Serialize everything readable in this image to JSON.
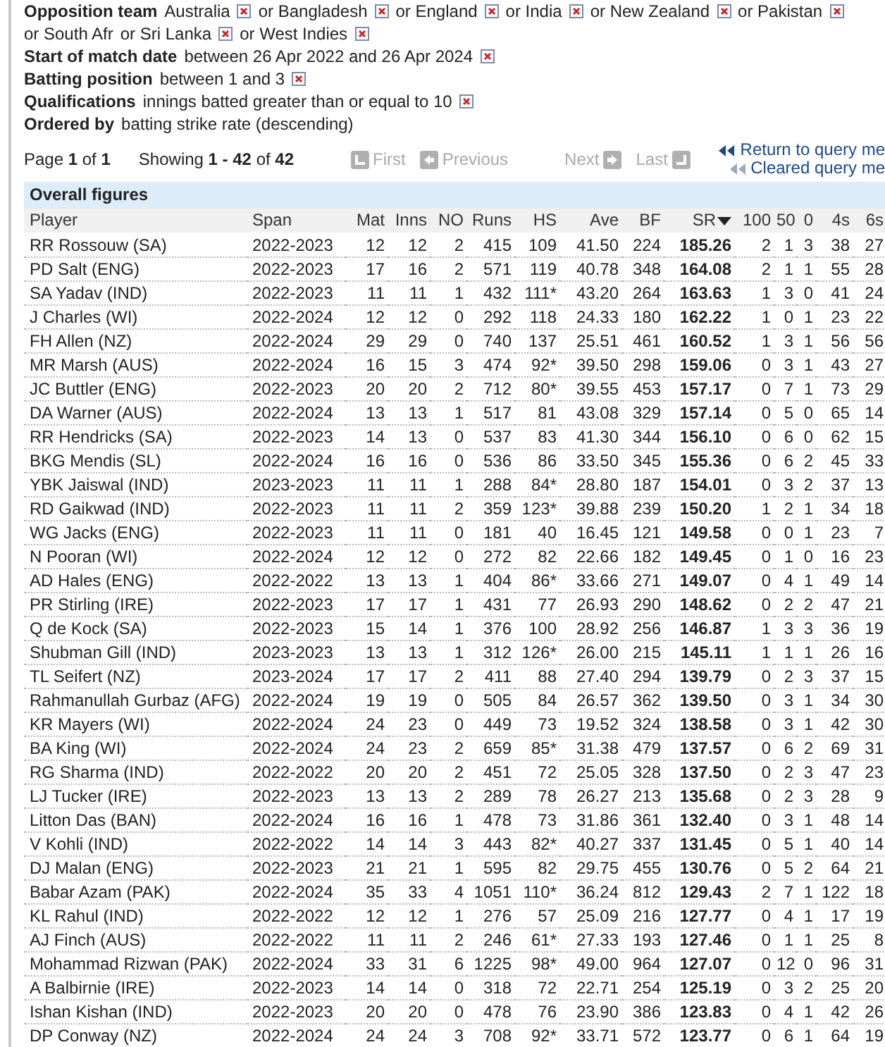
{
  "filters": [
    {
      "label": "Opposition team",
      "values": [
        {
          "text": "Australia",
          "remove_icon": true
        },
        {
          "text": "or Bangladesh",
          "remove_icon": true
        },
        {
          "text": "or England",
          "remove_icon": true
        },
        {
          "text": "or India",
          "remove_icon": true
        },
        {
          "text": "or New Zealand",
          "remove_icon": true
        },
        {
          "text": "or Pakistan",
          "remove_icon": true
        },
        {
          "text": "or South Afr"
        },
        {
          "text": "or Sri Lanka",
          "remove_icon": true
        },
        {
          "text": "or West Indies",
          "remove_icon": true
        }
      ]
    },
    {
      "label": "Start of match date",
      "values": [
        {
          "text": "between 26 Apr 2022 and 26 Apr 2024",
          "remove_icon": true
        }
      ]
    },
    {
      "label": "Batting position",
      "values": [
        {
          "text": "between 1 and 3",
          "remove_icon": true
        }
      ]
    },
    {
      "label": "Qualifications",
      "values": [
        {
          "text": "innings batted greater than or equal to 10",
          "remove_icon": true
        }
      ]
    },
    {
      "label": "Ordered by",
      "values": [
        {
          "text": "batting strike rate (descending)"
        }
      ]
    }
  ],
  "pagination": {
    "page": "Page **1** of **1**",
    "showing": "Showing **1 - 42** of **42**",
    "nav": [
      {
        "kind": "first",
        "label": "First",
        "disabled": true
      },
      {
        "kind": "previous",
        "label": "Previous",
        "disabled": true
      },
      {
        "kind": "next",
        "label": "Next",
        "disabled": true
      },
      {
        "kind": "last",
        "label": "Last",
        "disabled": true
      }
    ],
    "links": [
      {
        "kind": "return",
        "label": "Return to query me"
      },
      {
        "kind": "cleared",
        "label": "Cleared query me"
      }
    ]
  },
  "table": {
    "title": "Overall figures",
    "columns": [
      {
        "label": "Player",
        "sorted": false
      },
      {
        "label": "Span",
        "sorted": false
      },
      {
        "label": "Mat",
        "sorted": false
      },
      {
        "label": "Inns",
        "sorted": false
      },
      {
        "label": "NO",
        "sorted": false
      },
      {
        "label": "Runs",
        "sorted": false
      },
      {
        "label": "HS",
        "sorted": false
      },
      {
        "label": "Ave",
        "sorted": false
      },
      {
        "label": "BF",
        "sorted": false
      },
      {
        "label": "SR",
        "sorted": true
      },
      {
        "label": "100",
        "sorted": false
      },
      {
        "label": "50",
        "sorted": false
      },
      {
        "label": "0",
        "sorted": false
      },
      {
        "label": "4s",
        "sorted": false
      },
      {
        "label": "6s",
        "sorted": false
      }
    ],
    "rows": [
      [
        "RR Rossouw (SA)",
        "2022-2023",
        "12",
        "12",
        "2",
        "415",
        "109",
        "41.50",
        "224",
        "185.26",
        "2",
        "1",
        "3",
        "38",
        "27"
      ],
      [
        "PD Salt (ENG)",
        "2022-2023",
        "17",
        "16",
        "2",
        "571",
        "119",
        "40.78",
        "348",
        "164.08",
        "2",
        "1",
        "1",
        "55",
        "28"
      ],
      [
        "SA Yadav (IND)",
        "2022-2023",
        "11",
        "11",
        "1",
        "432",
        "111*",
        "43.20",
        "264",
        "163.63",
        "1",
        "3",
        "0",
        "41",
        "24"
      ],
      [
        "J Charles (WI)",
        "2022-2024",
        "12",
        "12",
        "0",
        "292",
        "118",
        "24.33",
        "180",
        "162.22",
        "1",
        "0",
        "1",
        "23",
        "22"
      ],
      [
        "FH Allen (NZ)",
        "2022-2024",
        "29",
        "29",
        "0",
        "740",
        "137",
        "25.51",
        "461",
        "160.52",
        "1",
        "3",
        "1",
        "56",
        "56"
      ],
      [
        "MR Marsh (AUS)",
        "2022-2024",
        "16",
        "15",
        "3",
        "474",
        "92*",
        "39.50",
        "298",
        "159.06",
        "0",
        "3",
        "1",
        "43",
        "27"
      ],
      [
        "JC Buttler (ENG)",
        "2022-2023",
        "20",
        "20",
        "2",
        "712",
        "80*",
        "39.55",
        "453",
        "157.17",
        "0",
        "7",
        "1",
        "73",
        "29"
      ],
      [
        "DA Warner (AUS)",
        "2022-2024",
        "13",
        "13",
        "1",
        "517",
        "81",
        "43.08",
        "329",
        "157.14",
        "0",
        "5",
        "0",
        "65",
        "14"
      ],
      [
        "RR Hendricks (SA)",
        "2022-2023",
        "14",
        "13",
        "0",
        "537",
        "83",
        "41.30",
        "344",
        "156.10",
        "0",
        "6",
        "0",
        "62",
        "15"
      ],
      [
        "BKG Mendis (SL)",
        "2022-2024",
        "16",
        "16",
        "0",
        "536",
        "86",
        "33.50",
        "345",
        "155.36",
        "0",
        "6",
        "2",
        "45",
        "33"
      ],
      [
        "YBK Jaiswal (IND)",
        "2023-2023",
        "11",
        "11",
        "1",
        "288",
        "84*",
        "28.80",
        "187",
        "154.01",
        "0",
        "3",
        "2",
        "37",
        "13"
      ],
      [
        "RD Gaikwad (IND)",
        "2022-2023",
        "11",
        "11",
        "2",
        "359",
        "123*",
        "39.88",
        "239",
        "150.20",
        "1",
        "2",
        "1",
        "34",
        "18"
      ],
      [
        "WG Jacks (ENG)",
        "2022-2023",
        "11",
        "11",
        "0",
        "181",
        "40",
        "16.45",
        "121",
        "149.58",
        "0",
        "0",
        "1",
        "23",
        "7"
      ],
      [
        "N Pooran (WI)",
        "2022-2024",
        "12",
        "12",
        "0",
        "272",
        "82",
        "22.66",
        "182",
        "149.45",
        "0",
        "1",
        "0",
        "16",
        "23"
      ],
      [
        "AD Hales (ENG)",
        "2022-2022",
        "13",
        "13",
        "1",
        "404",
        "86*",
        "33.66",
        "271",
        "149.07",
        "0",
        "4",
        "1",
        "49",
        "14"
      ],
      [
        "PR Stirling (IRE)",
        "2022-2023",
        "17",
        "17",
        "1",
        "431",
        "77",
        "26.93",
        "290",
        "148.62",
        "0",
        "2",
        "2",
        "47",
        "21"
      ],
      [
        "Q de Kock (SA)",
        "2022-2023",
        "15",
        "14",
        "1",
        "376",
        "100",
        "28.92",
        "256",
        "146.87",
        "1",
        "3",
        "3",
        "36",
        "19"
      ],
      [
        "Shubman Gill (IND)",
        "2023-2023",
        "13",
        "13",
        "1",
        "312",
        "126*",
        "26.00",
        "215",
        "145.11",
        "1",
        "1",
        "1",
        "26",
        "16"
      ],
      [
        "TL Seifert (NZ)",
        "2023-2024",
        "17",
        "17",
        "2",
        "411",
        "88",
        "27.40",
        "294",
        "139.79",
        "0",
        "2",
        "3",
        "37",
        "15"
      ],
      [
        "Rahmanullah Gurbaz (AFG)",
        "2022-2024",
        "19",
        "19",
        "0",
        "505",
        "84",
        "26.57",
        "362",
        "139.50",
        "0",
        "3",
        "1",
        "34",
        "30"
      ],
      [
        "KR Mayers (WI)",
        "2022-2024",
        "24",
        "23",
        "0",
        "449",
        "73",
        "19.52",
        "324",
        "138.58",
        "0",
        "3",
        "1",
        "42",
        "30"
      ],
      [
        "BA King (WI)",
        "2022-2024",
        "24",
        "23",
        "2",
        "659",
        "85*",
        "31.38",
        "479",
        "137.57",
        "0",
        "6",
        "2",
        "69",
        "31"
      ],
      [
        "RG Sharma (IND)",
        "2022-2022",
        "20",
        "20",
        "2",
        "451",
        "72",
        "25.05",
        "328",
        "137.50",
        "0",
        "2",
        "3",
        "47",
        "23"
      ],
      [
        "LJ Tucker (IRE)",
        "2022-2023",
        "13",
        "13",
        "2",
        "289",
        "78",
        "26.27",
        "213",
        "135.68",
        "0",
        "2",
        "3",
        "28",
        "9"
      ],
      [
        "Litton Das (BAN)",
        "2022-2024",
        "16",
        "16",
        "1",
        "478",
        "73",
        "31.86",
        "361",
        "132.40",
        "0",
        "3",
        "1",
        "48",
        "14"
      ],
      [
        "V Kohli (IND)",
        "2022-2022",
        "14",
        "14",
        "3",
        "443",
        "82*",
        "40.27",
        "337",
        "131.45",
        "0",
        "5",
        "1",
        "40",
        "14"
      ],
      [
        "DJ Malan (ENG)",
        "2022-2023",
        "21",
        "21",
        "1",
        "595",
        "82",
        "29.75",
        "455",
        "130.76",
        "0",
        "5",
        "2",
        "64",
        "21"
      ],
      [
        "Babar Azam (PAK)",
        "2022-2024",
        "35",
        "33",
        "4",
        "1051",
        "110*",
        "36.24",
        "812",
        "129.43",
        "2",
        "7",
        "1",
        "122",
        "18"
      ],
      [
        "KL Rahul (IND)",
        "2022-2022",
        "12",
        "12",
        "1",
        "276",
        "57",
        "25.09",
        "216",
        "127.77",
        "0",
        "4",
        "1",
        "17",
        "19"
      ],
      [
        "AJ Finch (AUS)",
        "2022-2022",
        "11",
        "11",
        "2",
        "246",
        "61*",
        "27.33",
        "193",
        "127.46",
        "0",
        "1",
        "1",
        "25",
        "8"
      ],
      [
        "Mohammad Rizwan (PAK)",
        "2022-2024",
        "33",
        "31",
        "6",
        "1225",
        "98*",
        "49.00",
        "964",
        "127.07",
        "0",
        "12",
        "0",
        "96",
        "31"
      ],
      [
        "A Balbirnie (IRE)",
        "2022-2023",
        "14",
        "14",
        "0",
        "318",
        "72",
        "22.71",
        "254",
        "125.19",
        "0",
        "3",
        "2",
        "25",
        "20"
      ],
      [
        "Ishan Kishan (IND)",
        "2022-2023",
        "20",
        "20",
        "0",
        "478",
        "76",
        "23.90",
        "386",
        "123.83",
        "0",
        "4",
        "1",
        "42",
        "26"
      ],
      [
        "DP Conway (NZ)",
        "2022-2024",
        "24",
        "24",
        "3",
        "708",
        "92*",
        "33.71",
        "572",
        "123.77",
        "0",
        "6",
        "1",
        "64",
        "19"
      ]
    ]
  }
}
